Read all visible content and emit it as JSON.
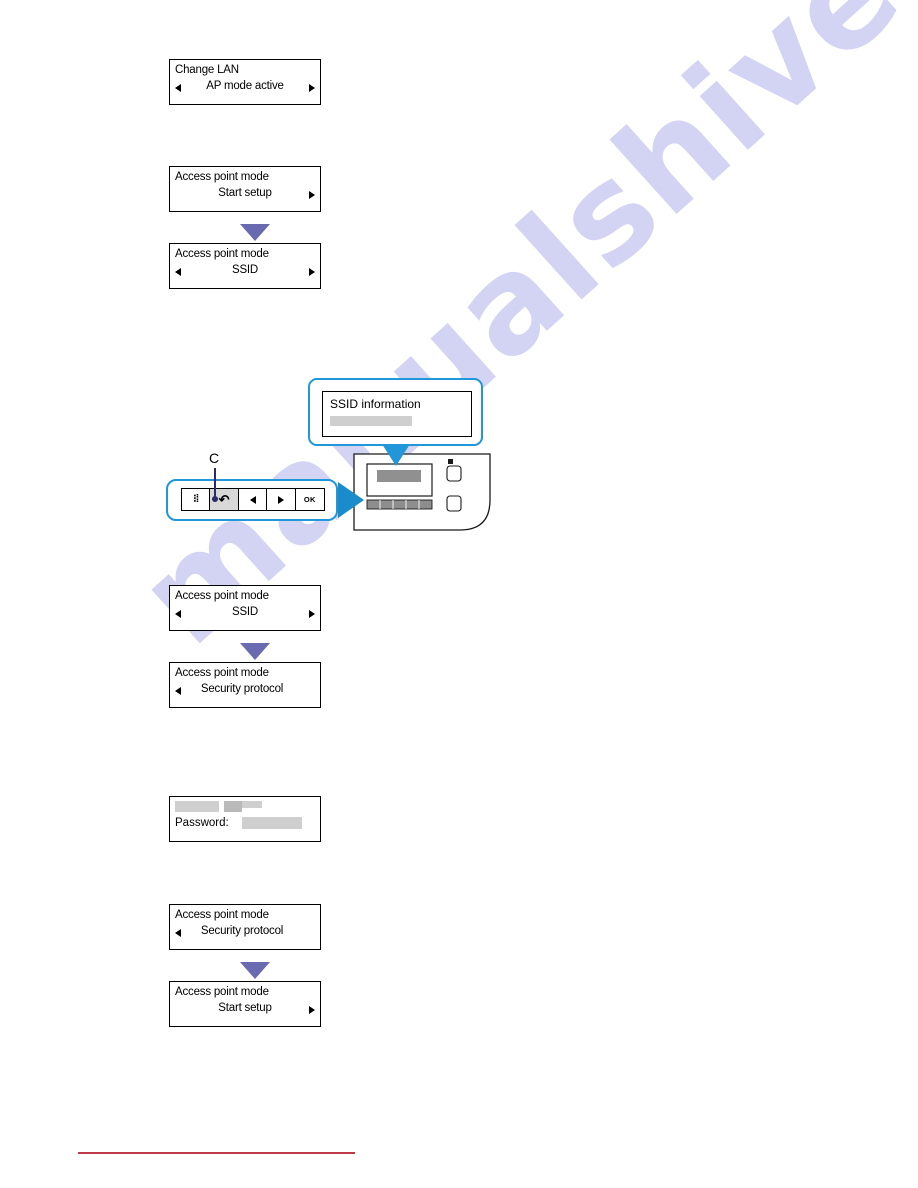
{
  "document": {
    "watermark": "manualshive.com"
  },
  "panels": {
    "change_lan": {
      "line1": "Change LAN",
      "line2": "AP mode active",
      "left_arrow": true,
      "right_arrow": true
    },
    "ap_start_setup_1": {
      "line1": "Access point mode",
      "line2": "Start setup",
      "left_arrow": false,
      "right_arrow": true
    },
    "ap_ssid_1": {
      "line1": "Access point mode",
      "line2": "SSID",
      "left_arrow": true,
      "right_arrow": true
    },
    "ap_ssid_2": {
      "line1": "Access point mode",
      "line2": "SSID",
      "left_arrow": true,
      "right_arrow": true
    },
    "ap_security_1": {
      "line1": "Access point mode",
      "line2": "Security protocol",
      "left_arrow": true,
      "right_arrow": false
    },
    "ap_security_2": {
      "line1": "Access point mode",
      "line2": "Security protocol",
      "left_arrow": true,
      "right_arrow": false
    },
    "ap_start_setup_2": {
      "line1": "Access point mode",
      "line2": "Start setup",
      "left_arrow": false,
      "right_arrow": true
    },
    "password": {
      "line1": "",
      "label": "Password:",
      "value": ""
    }
  },
  "callout": {
    "title": "SSID information",
    "value": ""
  },
  "control_panel": {
    "reference_label": "C",
    "buttons": [
      {
        "name": "maintenance",
        "glyph": "⚙"
      },
      {
        "name": "back",
        "glyph": "↶",
        "highlighted": true
      },
      {
        "name": "left-arrow",
        "glyph": "◀"
      },
      {
        "name": "right-arrow",
        "glyph": "▶"
      },
      {
        "name": "ok",
        "glyph": "OK"
      }
    ]
  },
  "colors": {
    "callout_border": "#2196d8",
    "transition_arrow": "#6a6ab0",
    "pointer_blue": "#1a8ccc",
    "leader_navy": "#2b2b6b",
    "footer_rule": "#c0394b",
    "watermark": "#cccdf2"
  }
}
